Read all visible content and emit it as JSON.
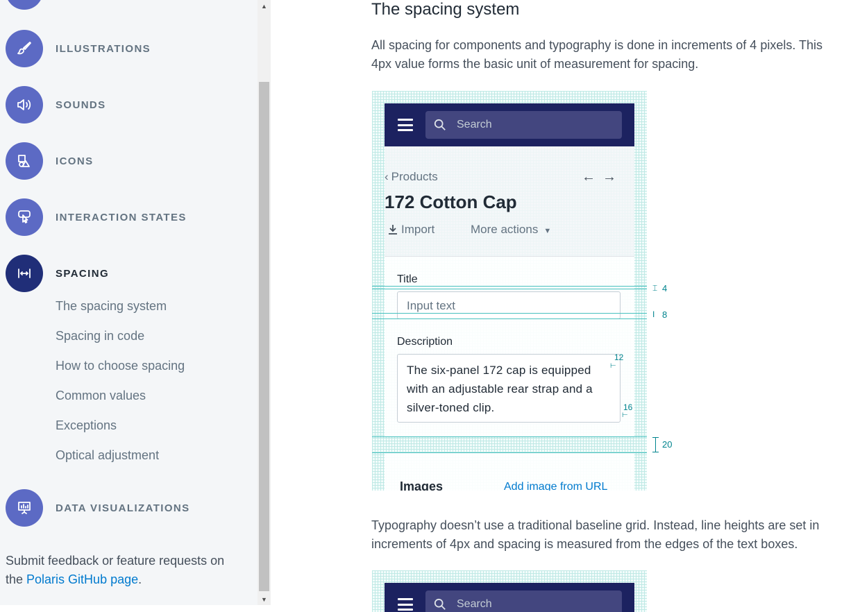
{
  "sidebar": {
    "nav_items": [
      {
        "label": "ILLUSTRATIONS",
        "icon": "brush-icon"
      },
      {
        "label": "SOUNDS",
        "icon": "speaker-icon"
      },
      {
        "label": "ICONS",
        "icon": "shapes-icon"
      },
      {
        "label": "INTERACTION STATES",
        "icon": "pointer-icon"
      },
      {
        "label": "SPACING",
        "icon": "spacing-icon",
        "active": true
      },
      {
        "label": "DATA VISUALIZATIONS",
        "icon": "presentation-chart-icon"
      }
    ],
    "sub_links": [
      "The spacing system",
      "Spacing in code",
      "How to choose spacing",
      "Common values",
      "Exceptions",
      "Optical adjustment"
    ],
    "feedback_text": "Submit feedback or feature requests on the ",
    "feedback_link": "Polaris GitHub page",
    "feedback_end": "."
  },
  "main": {
    "heading": "The spacing system",
    "intro": "All spacing for components and typography is done in increments of 4 pixels. This 4px value forms the basic unit of measurement for spacing.",
    "typography_para": "Typography doesn’t use a traditional baseline grid. Instead, line heights are set in increments of 4px and spacing is measured from the edges of the text boxes."
  },
  "figure": {
    "search_placeholder": "Search",
    "breadcrumb": "Products",
    "product_title": "172 Cotton Cap",
    "import_label": "Import",
    "more_actions_label": "More actions",
    "title_label": "Title",
    "title_placeholder": "Input text",
    "description_label": "Description",
    "description_value": "The six-panel 172 cap is equipped with an adjustable rear strap and a silver-toned clip.",
    "measurements": {
      "m4": "4",
      "m8": "8",
      "m12": "12",
      "m16": "16",
      "m20": "20"
    },
    "images_title": "Images",
    "images_link": "Add image from URL"
  },
  "colors": {
    "accent": "#5c6ac4",
    "accent_active": "#202e78",
    "link": "#007ace",
    "guide": "#47c1bf",
    "topbar": "#1c2260"
  }
}
